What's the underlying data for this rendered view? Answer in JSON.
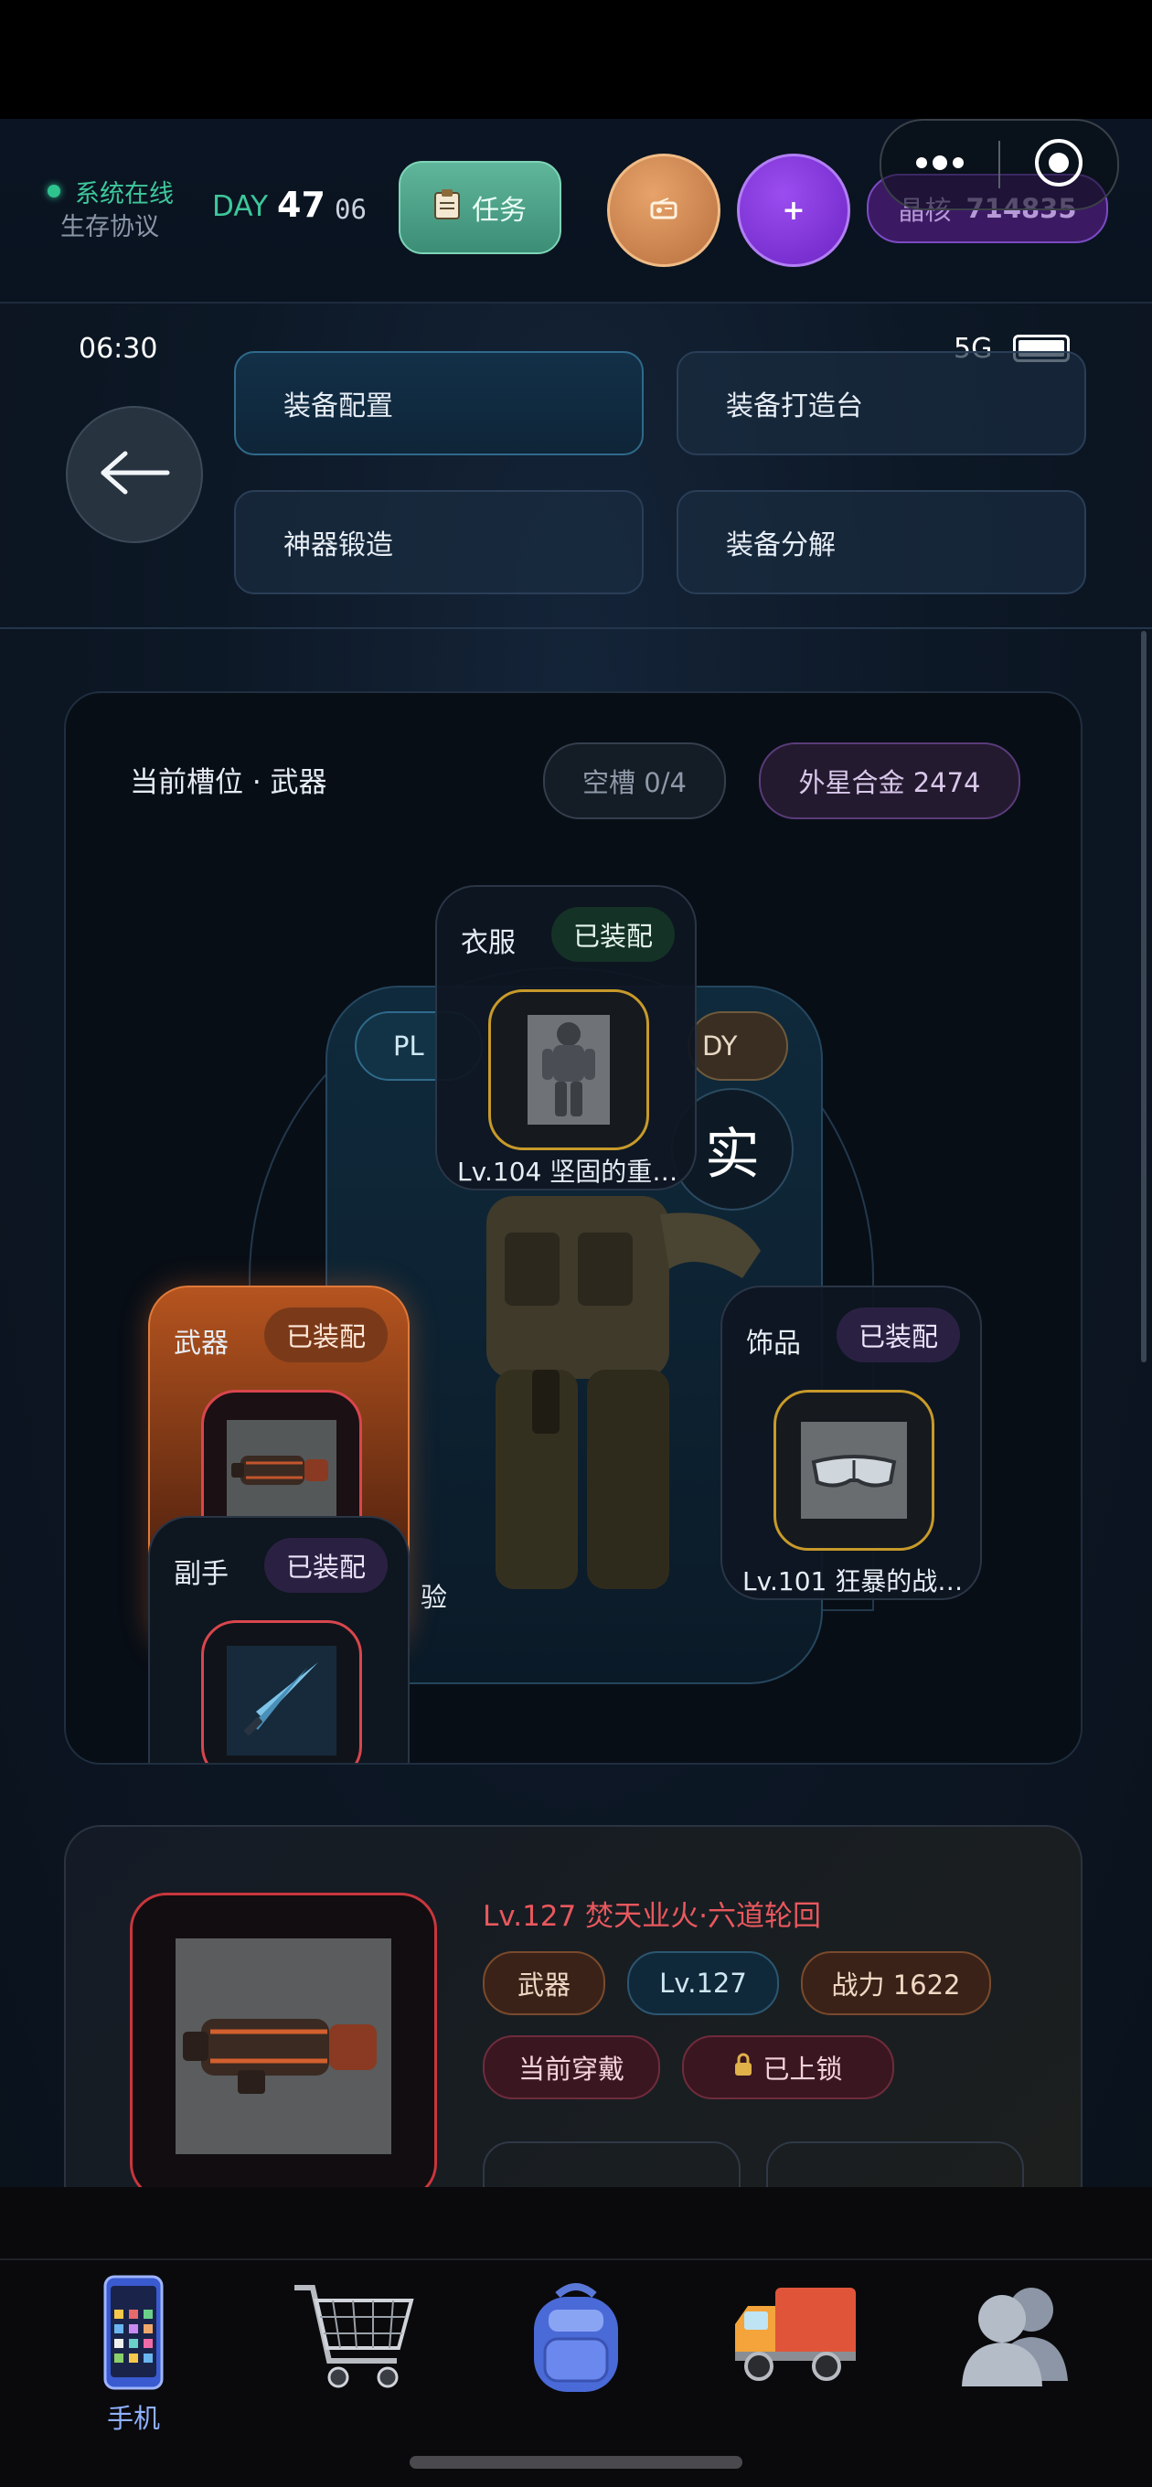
{
  "hud": {
    "status_online": "系统在线",
    "status_protocol": "生存协议",
    "day_label": "DAY",
    "day_number": "47",
    "day_sub": "06",
    "task_label": "任务",
    "crystal_label": "晶核",
    "crystal_value": "714835"
  },
  "statusbar": {
    "time": "06:30",
    "network": "5G"
  },
  "menu": {
    "items": [
      {
        "label": "装备配置"
      },
      {
        "label": "装备打造台"
      },
      {
        "label": "神器锻造"
      },
      {
        "label": "装备分解"
      }
    ]
  },
  "slot_panel": {
    "title": "当前槽位 · 武器",
    "empty_slots": "空槽 0/4",
    "alloy": "外星合金 2474",
    "tag_left": "PL",
    "tag_right": "DY",
    "char_glyph": "实",
    "partial_text": "验"
  },
  "slots": {
    "clothing": {
      "label": "衣服",
      "status": "已装配",
      "item": "Lv.104 坚固的重…"
    },
    "weapon": {
      "label": "武器",
      "status": "已装配"
    },
    "accessory": {
      "label": "饰品",
      "status": "已装配",
      "item": "Lv.101 狂暴的战…"
    },
    "offhand": {
      "label": "副手",
      "status": "已装配"
    }
  },
  "detail": {
    "name": "Lv.127 焚天业火·六道轮回",
    "tags": [
      "武器",
      "Lv.127",
      "战力 1622",
      "当前穿戴",
      "已上锁"
    ]
  },
  "nav": {
    "items": [
      {
        "label": "手机",
        "icon": "phone-icon",
        "active": true
      },
      {
        "label": "",
        "icon": "cart-icon"
      },
      {
        "label": "",
        "icon": "backpack-icon"
      },
      {
        "label": "",
        "icon": "truck-icon"
      },
      {
        "label": "",
        "icon": "users-icon"
      }
    ]
  },
  "colors": {
    "accent_green": "#3ec79a",
    "accent_purple": "#7b4bc4",
    "weapon_orange": "#c9622a",
    "danger_red": "#d9464d"
  }
}
